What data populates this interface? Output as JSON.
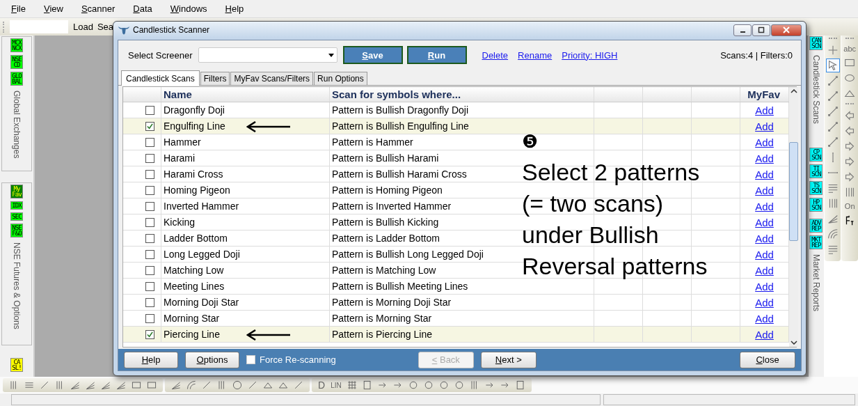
{
  "menu": [
    "File",
    "View",
    "Scanner",
    "Data",
    "Windows",
    "Help"
  ],
  "toolbar": {
    "buttons": [
      "Load",
      "Sea"
    ]
  },
  "left_sidebar": [
    {
      "caption": "Global Exchanges",
      "tags": [
        {
          "lines": [
            "MCX",
            "NCX"
          ],
          "color": "#00ff00"
        },
        {
          "lines": [
            "NSE",
            "CD"
          ],
          "color": "#00ff00"
        },
        {
          "lines": [
            "GLO",
            "BAL"
          ],
          "color": "#00ff00"
        }
      ]
    },
    {
      "caption": "NSE Futures & Options",
      "tags": [
        {
          "lines": [
            "My",
            "Fav"
          ],
          "color": "#008000"
        },
        {
          "lines": [
            "IDX"
          ],
          "color": "#00ff00"
        },
        {
          "lines": [
            "SEC"
          ],
          "color": "#00ff00"
        },
        {
          "lines": [
            "NSE",
            "F&O"
          ],
          "color": "#00ff00"
        }
      ]
    },
    {
      "tags": [
        {
          "lines": [
            "CA",
            "SL!"
          ],
          "color": "#ffff00"
        }
      ]
    }
  ],
  "right_sidebar": [
    {
      "caption": "Candlestick Scans",
      "tags": [
        {
          "lines": [
            "CAN",
            "SCN"
          ],
          "color": "#00ffff"
        }
      ]
    },
    {
      "tags": [
        {
          "lines": [
            "CP",
            "SCN"
          ],
          "color": "#00ffff"
        },
        {
          "lines": [
            "TI",
            "SCN"
          ],
          "color": "#00ffff"
        },
        {
          "lines": [
            "TS",
            "SCN"
          ],
          "color": "#00ffff"
        },
        {
          "lines": [
            "HP",
            "SCN"
          ],
          "color": "#00ffff"
        }
      ]
    },
    {
      "caption": "Market Reports",
      "tags": [
        {
          "lines": [
            "ADV",
            "REP"
          ],
          "color": "#00ffff"
        },
        {
          "lines": [
            "MKT",
            "REP"
          ],
          "color": "#00ffff"
        }
      ]
    }
  ],
  "drawing_toolbar": {
    "text_tools": [
      "abc",
      "On"
    ]
  },
  "dialog": {
    "title": "Candlestick Scanner",
    "screener_label": "Select Screener",
    "buttons": [
      "Save",
      "Run"
    ],
    "links": [
      "Delete",
      "Rename",
      "Priority: HIGH"
    ],
    "counts": "Scans:4 | Filters:0",
    "tabs": [
      {
        "label": "Candlestick Scans",
        "selected": true
      },
      {
        "label": "Filters",
        "selected": false
      },
      {
        "label": "MyFav Scans/Filters",
        "selected": false
      },
      {
        "label": "Run Options",
        "selected": false
      }
    ],
    "table": {
      "columns": [
        "Name",
        "Scan for symbols where...",
        "MyFav"
      ],
      "rows": [
        {
          "checked": false,
          "name": "Dragonfly Doji",
          "condition": "Pattern is Bullish Dragonfly Doji",
          "myfav": "Add",
          "arrow": false
        },
        {
          "checked": true,
          "name": "Engulfing Line",
          "condition": "Pattern is Bullish Engulfing Line",
          "myfav": "Add",
          "arrow": true
        },
        {
          "checked": false,
          "name": "Hammer",
          "condition": "Pattern is Hammer",
          "myfav": "Add",
          "arrow": false
        },
        {
          "checked": false,
          "name": "Harami",
          "condition": "Pattern is Bullish Harami",
          "myfav": "Add",
          "arrow": false
        },
        {
          "checked": false,
          "name": "Harami Cross",
          "condition": "Pattern is Bullish Harami Cross",
          "myfav": "Add",
          "arrow": false
        },
        {
          "checked": false,
          "name": "Homing Pigeon",
          "condition": "Pattern is Homing Pigeon",
          "myfav": "Add",
          "arrow": false
        },
        {
          "checked": false,
          "name": "Inverted Hammer",
          "condition": "Pattern is Inverted Hammer",
          "myfav": "Add",
          "arrow": false
        },
        {
          "checked": false,
          "name": "Kicking",
          "condition": "Pattern is Bullish Kicking",
          "myfav": "Add",
          "arrow": false
        },
        {
          "checked": false,
          "name": "Ladder Bottom",
          "condition": "Pattern is Ladder Bottom",
          "myfav": "Add",
          "arrow": false
        },
        {
          "checked": false,
          "name": "Long Legged Doji",
          "condition": "Pattern is Bullish Long Legged Doji",
          "myfav": "Add",
          "arrow": false
        },
        {
          "checked": false,
          "name": "Matching Low",
          "condition": "Pattern is Matching Low",
          "myfav": "Add",
          "arrow": false
        },
        {
          "checked": false,
          "name": "Meeting Lines",
          "condition": "Pattern is Bullish Meeting Lines",
          "myfav": "Add",
          "arrow": false
        },
        {
          "checked": false,
          "name": "Morning Doji Star",
          "condition": "Pattern is Morning Doji Star",
          "myfav": "Add",
          "arrow": false
        },
        {
          "checked": false,
          "name": "Morning Star",
          "condition": "Pattern is Morning Star",
          "myfav": "Add",
          "arrow": false
        },
        {
          "checked": true,
          "name": "Piercing Line",
          "condition": "Pattern is Piercing Line",
          "myfav": "Add",
          "arrow": true
        }
      ]
    },
    "footer": {
      "left_buttons": [
        "Help",
        "Options"
      ],
      "force_rescanning": {
        "label": "Force Re-scanning",
        "checked": false
      },
      "back": {
        "label": "< Back",
        "disabled": true
      },
      "next": {
        "label": "Next >",
        "disabled": false
      },
      "close": "Close"
    },
    "annotation": {
      "marker": "❺",
      "lines": [
        "Select 2 patterns",
        "(= two scans)",
        "under Bullish",
        "Reversal patterns"
      ]
    }
  },
  "bottom_toolbar": {
    "text_tools": [
      "D",
      "LIN"
    ]
  }
}
